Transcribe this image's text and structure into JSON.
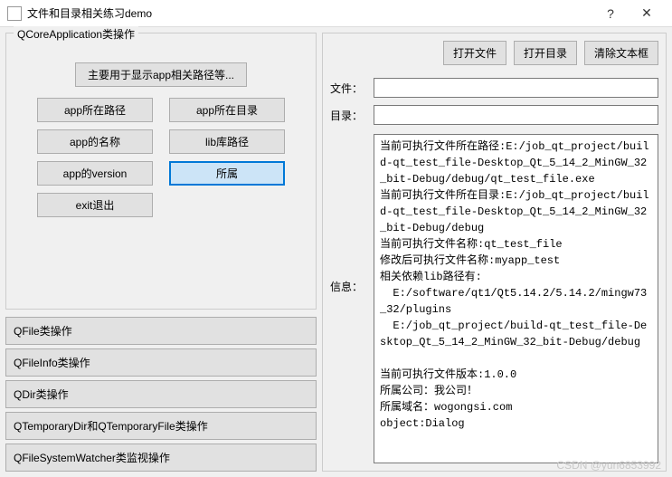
{
  "window": {
    "title": "文件和目录相关练习demo",
    "help": "?",
    "close": "✕"
  },
  "leftPanel": {
    "groupTitle": "QCoreApplication类操作",
    "mainDescBtn": "主要用于显示app相关路径等...",
    "gridButtons": {
      "appPath": "app所在路径",
      "appDir": "app所在目录",
      "appName": "app的名称",
      "libPath": "lib库路径",
      "appVersion": "app的version",
      "belong": "所属",
      "exit": "exit退出"
    },
    "sections": {
      "qfile": "QFile类操作",
      "qfileinfo": "QFileInfo类操作",
      "qdir": "QDir类操作",
      "qtemp": "QTemporaryDir和QTemporaryFile类操作",
      "qwatcher": "QFileSystemWatcher类监视操作"
    }
  },
  "rightPanel": {
    "topButtons": {
      "openFile": "打开文件",
      "openDir": "打开目录",
      "clearText": "清除文本框"
    },
    "labels": {
      "file": "文件：",
      "dir": "目录：",
      "info": "信息："
    },
    "fileValue": "",
    "dirValue": "",
    "infoText": "当前可执行文件所在路径:E:/job_qt_project/build-qt_test_file-Desktop_Qt_5_14_2_MinGW_32_bit-Debug/debug/qt_test_file.exe\n当前可执行文件所在目录:E:/job_qt_project/build-qt_test_file-Desktop_Qt_5_14_2_MinGW_32_bit-Debug/debug\n当前可执行文件名称:qt_test_file\n修改后可执行文件名称:myapp_test\n相关依赖lib路径有:\n  E:/software/qt1/Qt5.14.2/5.14.2/mingw73_32/plugins\n  E:/job_qt_project/build-qt_test_file-Desktop_Qt_5_14_2_MinGW_32_bit-Debug/debug\n\n当前可执行文件版本:1.0.0\n所属公司：我公司！\n所属域名：wogongsi.com\nobject:Dialog"
  },
  "watermark": "CSDN @yun6853992"
}
